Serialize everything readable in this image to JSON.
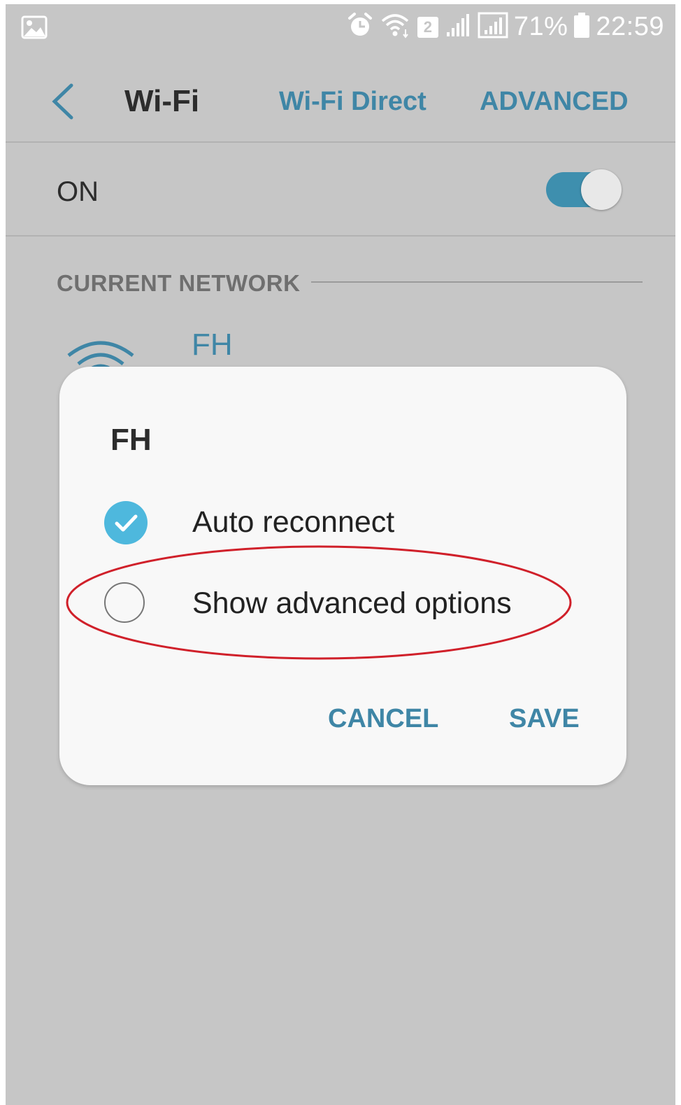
{
  "status_bar": {
    "battery_percent": "71%",
    "time": "22:59",
    "sim_label": "2",
    "icons": [
      "gallery-icon",
      "alarm-icon",
      "wifi-icon",
      "sim-icon",
      "signal-icon",
      "signal-icon",
      "battery-icon"
    ]
  },
  "header": {
    "title": "Wi-Fi",
    "wifi_direct_label": "Wi-Fi Direct",
    "advanced_label": "ADVANCED"
  },
  "toggle_row": {
    "label": "ON",
    "state_on": true,
    "accent": "#3e8fae"
  },
  "current_network": {
    "section_label": "CURRENT NETWORK",
    "network_name": "FH"
  },
  "dialog": {
    "title": "FH",
    "options": [
      {
        "label": "Auto reconnect",
        "checked": true
      },
      {
        "label": "Show advanced options",
        "checked": false
      }
    ],
    "cancel_label": "CANCEL",
    "save_label": "SAVE"
  },
  "colors": {
    "accent": "#3f86a6",
    "check": "#4eb8dd",
    "annotation": "#d0202a",
    "scrim": "#c6c6c6"
  }
}
